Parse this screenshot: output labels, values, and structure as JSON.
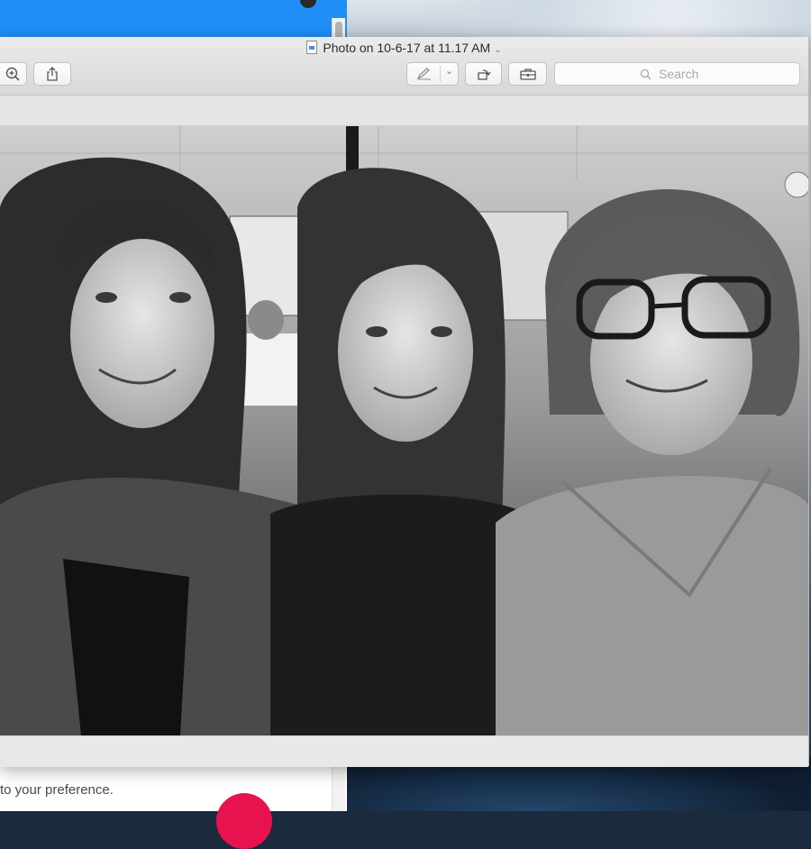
{
  "background_app": {
    "preference_text": "to your preference.",
    "accent_color": "#1f8ff7",
    "button_color": "#e8134e"
  },
  "window": {
    "title": "Photo on 10-6-17 at 11.17 AM",
    "toolbar": {
      "zoom_icon": "zoom-in-icon",
      "share_icon": "share-icon",
      "markup_icon": "pen-icon",
      "rotate_icon": "rotate-icon",
      "toolbox_icon": "toolbox-icon"
    },
    "search": {
      "placeholder": "Search"
    }
  },
  "photo": {
    "style": "black-and-white",
    "subjects": 3
  }
}
